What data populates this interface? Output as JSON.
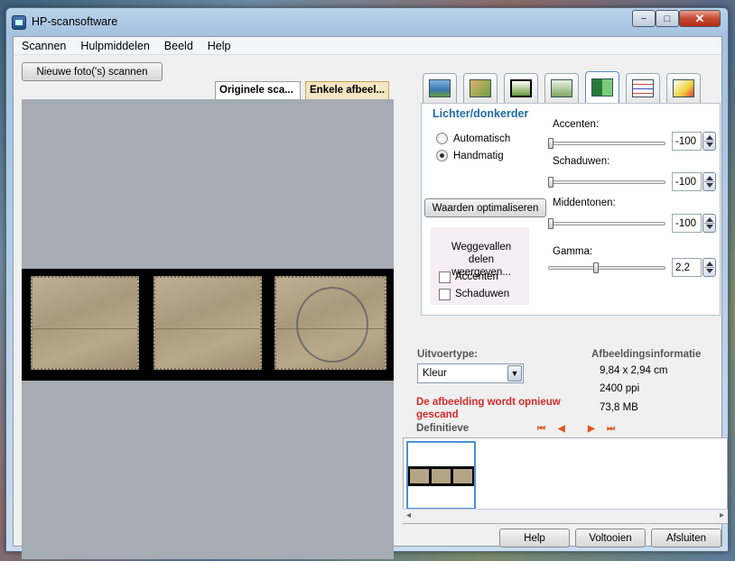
{
  "window": {
    "title": "HP-scansoftware",
    "controls": {
      "minimize": "−",
      "maximize": "□",
      "close": "✕"
    }
  },
  "menu": [
    "Scannen",
    "Hulpmiddelen",
    "Beeld",
    "Help"
  ],
  "toolbar": {
    "scan_new": "Nieuwe foto('s) scannen"
  },
  "preview_tabs": [
    "Originele sca...",
    "Enkele afbeel..."
  ],
  "tool_tabs": [
    {
      "name": "scan-setup-icon"
    },
    {
      "name": "resize-icon"
    },
    {
      "name": "crop-icon"
    },
    {
      "name": "frame-icon"
    },
    {
      "name": "exposure-icon"
    },
    {
      "name": "color-adjust-icon"
    },
    {
      "name": "magic-wand-icon"
    }
  ],
  "panel": {
    "title": "Lichter/donkerder",
    "radio_auto": "Automatisch",
    "radio_manual": "Handmatig",
    "selected_mode": "manual",
    "optimize_button": "Waarden optimaliseren",
    "clipped_title": "Weggevallen delen weergeven...",
    "check_highlights": "Accenten",
    "check_shadows": "Schaduwen",
    "sliders": [
      {
        "label": "Accenten:",
        "value": "-100",
        "level": 0.0
      },
      {
        "label": "Schaduwen:",
        "value": "-100",
        "level": 0.0
      },
      {
        "label": "Middentonen:",
        "value": "-100",
        "level": 0.0
      },
      {
        "label": "Gamma:",
        "value": "2,2",
        "level": 0.4
      }
    ]
  },
  "output": {
    "type_label": "Uitvoertype:",
    "type_value": "Kleur",
    "warning": "De afbeelding wordt opnieuw gescand",
    "final_label": "Definitieve"
  },
  "image_info": {
    "label": "Afbeeldingsinformatie",
    "size": "9,84 x 2,94 cm",
    "resolution": "2400 ppi",
    "filesize": "73,8 MB"
  },
  "nav_arrows": [
    "⏮",
    "◀",
    "▶",
    "⏭"
  ],
  "scroll_arrows": {
    "left": "◂",
    "right": "▸"
  },
  "bottom_buttons": {
    "help": "Help",
    "finish": "Voltooien",
    "close": "Afsluiten"
  },
  "colors": {
    "accent": "#1e6aa8",
    "warning": "#d42a2a",
    "nav": "#e0551d"
  }
}
